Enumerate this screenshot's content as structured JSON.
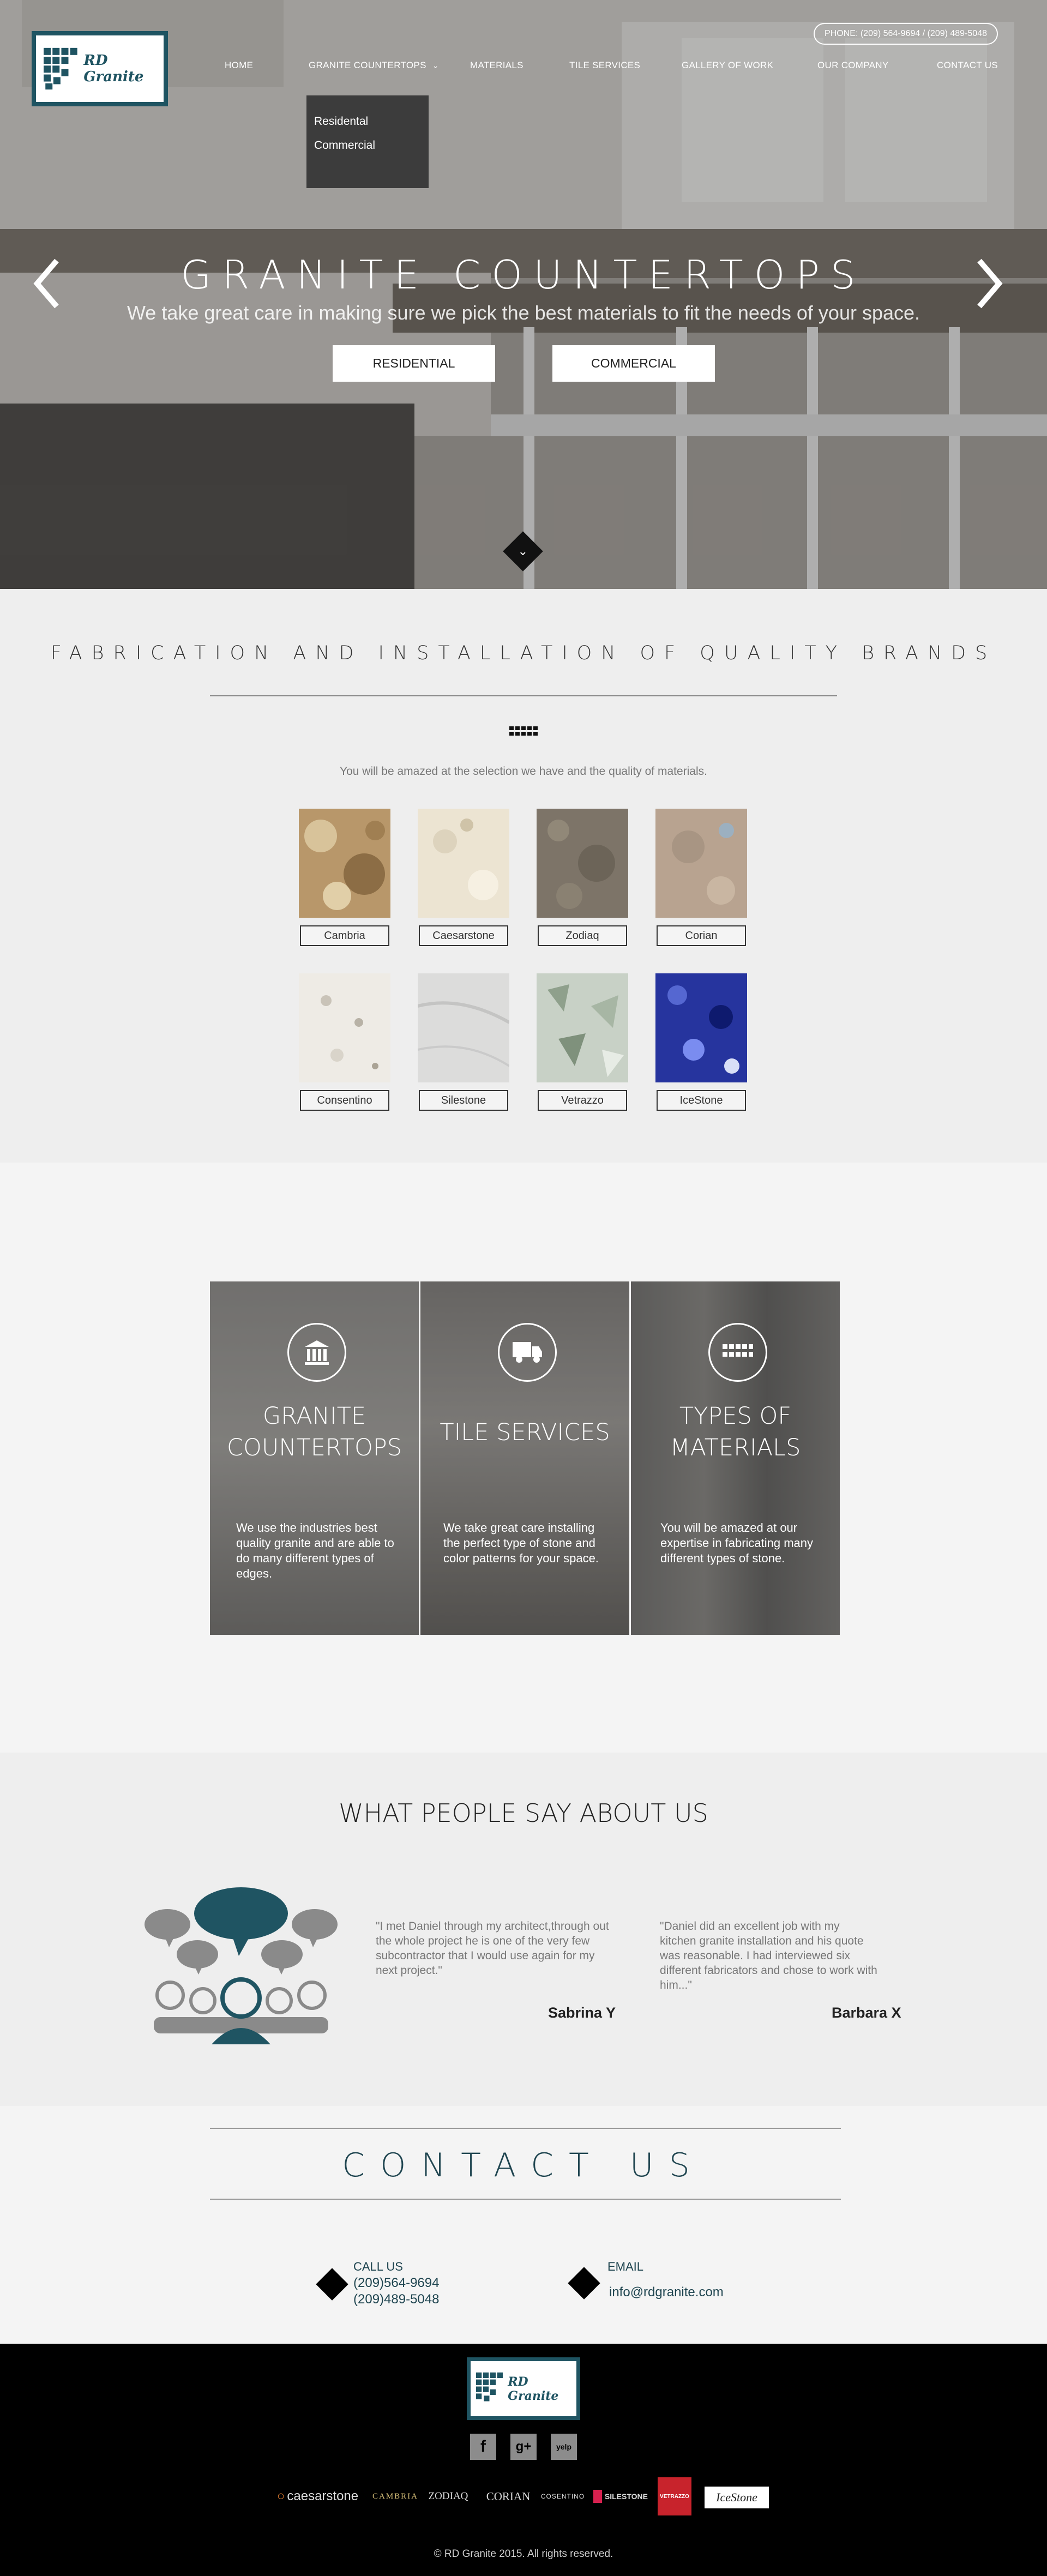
{
  "header": {
    "logo_text": "RD Granite",
    "phone": "PHONE: (209) 564-9694 / (209) 489-5048",
    "nav": [
      {
        "label": "HOME"
      },
      {
        "label": "GRANITE COUNTERTOPS"
      },
      {
        "label": "MATERIALS"
      },
      {
        "label": "TILE SERVICES"
      },
      {
        "label": "GALLERY OF WORK"
      },
      {
        "label": "OUR COMPANY"
      },
      {
        "label": "CONTACT US"
      }
    ],
    "dropdown": [
      "Residental",
      "Commercial"
    ]
  },
  "hero": {
    "title": "GRANITE COUNTERTOPS",
    "subtitle": "We take great care in making sure we pick the best materials to fit the needs of your space.",
    "buttons": [
      "RESIDENTIAL",
      "COMMERCIAL"
    ]
  },
  "brands": {
    "title": "FABRICATION AND INSTALLATION OF QUALITY BRANDS",
    "intro": "You will be amazed at the selection we have and the quality of materials.",
    "items": [
      {
        "label": "Cambria"
      },
      {
        "label": "Caesarstone"
      },
      {
        "label": "Zodiaq"
      },
      {
        "label": "Corian"
      },
      {
        "label": "Consentino"
      },
      {
        "label": "Silestone"
      },
      {
        "label": "Vetrazzo"
      },
      {
        "label": "IceStone"
      }
    ]
  },
  "services": [
    {
      "title": "GRANITE COUNTERTOPS",
      "desc": "We use the industries best quality granite and are able to do many different types of edges.",
      "icon": "bank-icon"
    },
    {
      "title": "TILE SERVICES",
      "desc": "We take great care installing the perfect type of stone and color patterns for your space.",
      "icon": "truck-icon"
    },
    {
      "title": "TYPES OF MATERIALS",
      "desc": "You will be amazed at our expertise in fabricating many different types of stone.",
      "icon": "grid-icon"
    }
  ],
  "testimonials": {
    "title": "WHAT PEOPLE SAY ABOUT US",
    "items": [
      {
        "quote": "\"I met Daniel through my architect,through out the whole project he is one of the very few subcontractor that I would use again for my next project.\"",
        "name": "Sabrina Y"
      },
      {
        "quote": "\"Daniel did an excellent job with my kitchen granite installation and his quote was reasonable.  I had interviewed six different fabricators and chose to work with him...\"",
        "name": "Barbara X"
      }
    ]
  },
  "contact": {
    "title": "CONTACT US",
    "call_label": "CALL US",
    "phone1": "(209)564-9694",
    "phone2": "(209)489-5048",
    "email_label": "EMAIL",
    "email": "info@rdgranite.com"
  },
  "footer": {
    "logo_text": "RD Granite",
    "social": [
      {
        "glyph": "f"
      },
      {
        "glyph": "g+"
      },
      {
        "glyph": "yelp"
      }
    ],
    "brand_logos": [
      {
        "text": "caesarstone"
      },
      {
        "text": "CAMBRIA"
      },
      {
        "text": "ZODIAQ"
      },
      {
        "text": "CORIAN"
      },
      {
        "text": "COSENTINO"
      },
      {
        "text": "SILESTONE"
      },
      {
        "text": "VETRAZZO"
      },
      {
        "text": "IceStone"
      }
    ],
    "copyright": "© RD Granite 2015. All rights reserved."
  }
}
